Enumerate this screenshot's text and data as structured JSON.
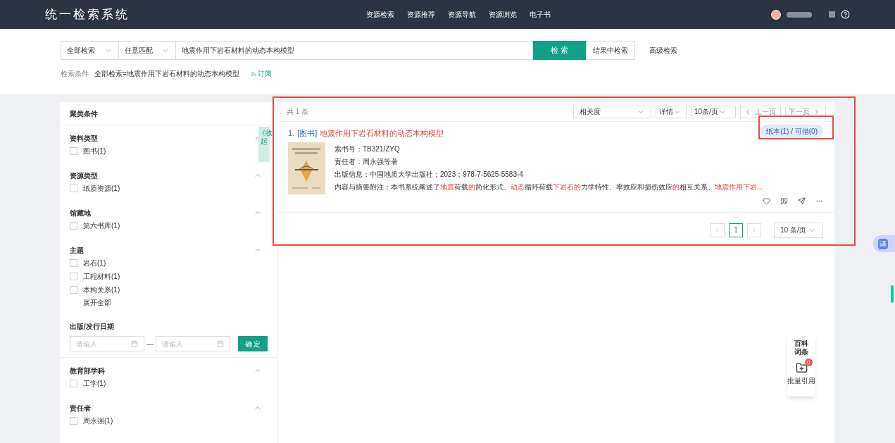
{
  "header": {
    "title": "统一检索系统",
    "nav": [
      {
        "label": "资源检索"
      },
      {
        "label": "资源推荐"
      },
      {
        "label": "资源导航"
      },
      {
        "label": "资源浏览"
      },
      {
        "label": "电子书"
      }
    ]
  },
  "search": {
    "scope": "全部检索",
    "match": "任意匹配",
    "query": "地震作用下岩石材料的动态本构模型",
    "search_button": "检 索",
    "refine_button": "结果中检索",
    "advanced_link": "高级检索",
    "condition_label": "检索条件",
    "condition": "全部检索=地震作用下岩石材料的动态本构模型",
    "subscribe": "订阅"
  },
  "sidebar": {
    "title": "聚类条件",
    "collapse_tab": "《收起",
    "facets": [
      {
        "kind": "checklist",
        "title": "资料类型",
        "expanded": true,
        "options": [
          {
            "label": "图书(1)",
            "checked": false
          }
        ]
      },
      {
        "kind": "checklist",
        "title": "资源类型",
        "expanded": true,
        "options": [
          {
            "label": "纸质资源(1)",
            "checked": false
          }
        ]
      },
      {
        "kind": "checklist",
        "title": "馆藏地",
        "expanded": true,
        "options": [
          {
            "label": "第六书库(1)",
            "checked": false
          }
        ]
      },
      {
        "kind": "checklist",
        "title": "主题",
        "expanded": true,
        "options": [
          {
            "label": "岩石(1)",
            "checked": false
          },
          {
            "label": "工程材料(1)",
            "checked": false
          },
          {
            "label": "本构关系(1)",
            "checked": false
          }
        ],
        "more": "展开全部"
      },
      {
        "kind": "date_range",
        "title": "出版/发行日期",
        "from_placeholder": "请输入",
        "to_placeholder": "请输入",
        "separator": "—",
        "button": "确 定"
      },
      {
        "kind": "checklist",
        "title": "教育部学科",
        "expanded": true,
        "options": [
          {
            "label": "工学(1)",
            "checked": false
          }
        ]
      },
      {
        "kind": "checklist",
        "title": "责任者",
        "expanded": true,
        "options": [
          {
            "label": "周永强(1)",
            "checked": false
          }
        ]
      }
    ]
  },
  "results": {
    "count": "共 1 条",
    "sort": "相关度",
    "view": "详情",
    "page_size": "10条/页",
    "prev": "上一页",
    "next": "下一页",
    "items": [
      {
        "index": "1.",
        "type": "[图书]",
        "title": "地震作用下岩石材料的动态本构模型",
        "holdings": "纸本(1) / 可借(0)",
        "fields": [
          {
            "label": "索书号：",
            "value": "TB321/ZYQ"
          },
          {
            "label": "责任者：",
            "value": "周永强等著"
          },
          {
            "label": "出版信息：",
            "value": "中国地质大学出版社；2023；978-7-5625-5583-4"
          }
        ],
        "summary_label": "内容与摘要附注：",
        "summary": [
          {
            "text": "本书系统阐述了",
            "hit": false
          },
          {
            "text": "地震",
            "hit": true
          },
          {
            "text": "荷载",
            "hit": false
          },
          {
            "text": "的",
            "hit": true
          },
          {
            "text": "简化形式、",
            "hit": false
          },
          {
            "text": "动态",
            "hit": true
          },
          {
            "text": "循环荷载",
            "hit": false
          },
          {
            "text": "下岩石的",
            "hit": true
          },
          {
            "text": "力学特性、率效应和损伤效应",
            "hit": false
          },
          {
            "text": "的",
            "hit": true
          },
          {
            "text": "相互关系、",
            "hit": false
          },
          {
            "text": "地震作用下岩...",
            "hit": true
          }
        ]
      }
    ],
    "pager": {
      "pages": [
        {
          "label": "1",
          "selected": true
        }
      ],
      "page_size": "10 条/页"
    }
  },
  "float": {
    "translate": "译",
    "encyclopedia": "百科词条",
    "cite_count": "0",
    "cite_label": "批量引用"
  }
}
